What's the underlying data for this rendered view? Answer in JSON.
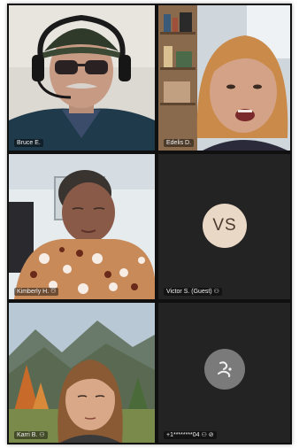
{
  "participants": [
    {
      "name": "Bruce E."
    },
    {
      "name": "Edelis D."
    },
    {
      "name": "Kimberly H. ⚇"
    },
    {
      "name": "Victor S. (Guest) ⚇",
      "initials": "VS"
    },
    {
      "name": "Karri B. ⚇"
    },
    {
      "name": "+1********04 ⚇ ⊘",
      "avatar_icon": "phone-caller-icon"
    }
  ],
  "colors": {
    "tile_background": "#232323",
    "avatar_initials_bg": "#ead8c6",
    "avatar_icon_bg": "#7a7a7a"
  }
}
